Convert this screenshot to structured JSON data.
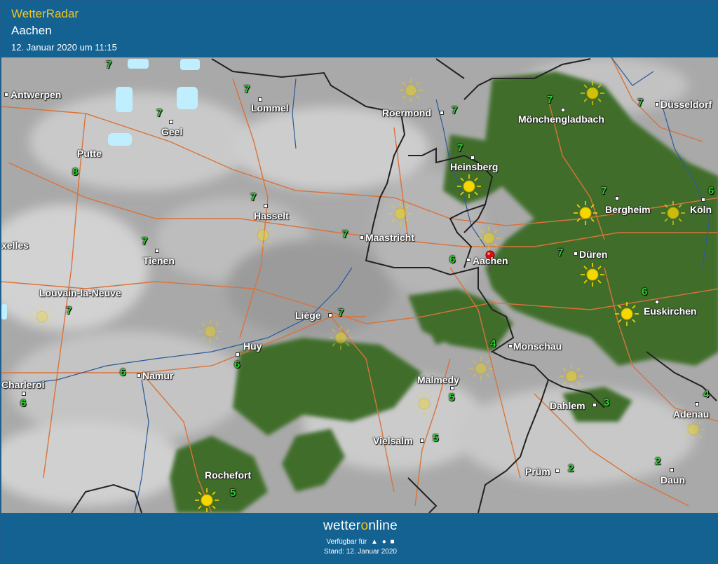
{
  "header": {
    "brand": "WetterRadar",
    "city": "Aachen",
    "date": "12. Januar 2020 um 11:15"
  },
  "map": {
    "selected_location": "Aachen",
    "places": [
      {
        "name": "Antwerpen",
        "id": "antwerpen"
      },
      {
        "name": "Lommel",
        "id": "lommel"
      },
      {
        "name": "Roermond",
        "id": "roermond"
      },
      {
        "name": "Mönchengladbach",
        "id": "moenchengladbach"
      },
      {
        "name": "Düsseldorf",
        "id": "duesseldorf"
      },
      {
        "name": "Geel",
        "id": "geel"
      },
      {
        "name": "Putte",
        "id": "putte"
      },
      {
        "name": "Heinsberg",
        "id": "heinsberg"
      },
      {
        "name": "Hasselt",
        "id": "hasselt"
      },
      {
        "name": "Bergheim",
        "id": "bergheim"
      },
      {
        "name": "Köln",
        "id": "koeln"
      },
      {
        "name": "Maastricht",
        "id": "maastricht"
      },
      {
        "name": "xelles",
        "id": "bruxelles"
      },
      {
        "name": "Tienen",
        "id": "tienen"
      },
      {
        "name": "Düren",
        "id": "dueren"
      },
      {
        "name": "Aachen",
        "id": "aachen"
      },
      {
        "name": "Louvain-la-Neuve",
        "id": "louvain"
      },
      {
        "name": "Euskirchen",
        "id": "euskirchen"
      },
      {
        "name": "Liège",
        "id": "liege"
      },
      {
        "name": "Huy",
        "id": "huy"
      },
      {
        "name": "Monschau",
        "id": "monschau"
      },
      {
        "name": "Namur",
        "id": "namur"
      },
      {
        "name": "Charleroi",
        "id": "charleroi"
      },
      {
        "name": "Malmedy",
        "id": "malmedy"
      },
      {
        "name": "Dahlem",
        "id": "dahlem"
      },
      {
        "name": "Adenau",
        "id": "adenau"
      },
      {
        "name": "Vielsalm",
        "id": "vielsalm"
      },
      {
        "name": "Rochefort",
        "id": "rochefort"
      },
      {
        "name": "Prüm",
        "id": "pruem"
      },
      {
        "name": "Daun",
        "id": "daun"
      }
    ],
    "temperatures": [
      {
        "id": "t-north",
        "value": "7"
      },
      {
        "id": "t-lommel",
        "value": "7"
      },
      {
        "id": "t-roermond",
        "value": "7"
      },
      {
        "id": "t-mg",
        "value": "7"
      },
      {
        "id": "t-dus",
        "value": "7"
      },
      {
        "id": "t-geel",
        "value": "7"
      },
      {
        "id": "t-putte",
        "value": "8"
      },
      {
        "id": "t-heinsberg",
        "value": "7"
      },
      {
        "id": "t-hasselt",
        "value": "7"
      },
      {
        "id": "t-bergheim",
        "value": "7"
      },
      {
        "id": "t-koeln",
        "value": "6"
      },
      {
        "id": "t-maastricht",
        "value": "7"
      },
      {
        "id": "t-tienen",
        "value": "7"
      },
      {
        "id": "t-dueren",
        "value": "7"
      },
      {
        "id": "t-aachen",
        "value": "6"
      },
      {
        "id": "t-louvain",
        "value": "7"
      },
      {
        "id": "t-euskirchen",
        "value": "6"
      },
      {
        "id": "t-liege",
        "value": "7"
      },
      {
        "id": "t-huy",
        "value": "6"
      },
      {
        "id": "t-monschau",
        "value": "4"
      },
      {
        "id": "t-namur",
        "value": "6"
      },
      {
        "id": "t-charleroi",
        "value": "6"
      },
      {
        "id": "t-malmedy",
        "value": "5"
      },
      {
        "id": "t-dahlem",
        "value": "3"
      },
      {
        "id": "t-adenau",
        "value": "4"
      },
      {
        "id": "t-vielsalm",
        "value": "5"
      },
      {
        "id": "t-rochefort",
        "value": "5"
      },
      {
        "id": "t-pruem",
        "value": "2"
      },
      {
        "id": "t-daun",
        "value": "2"
      }
    ],
    "colors": {
      "cloud": "#a9a9a9",
      "forest": "#3c6b2a",
      "roads": "#d9733a",
      "borders": "#222222",
      "rivers": "#2a5a9a",
      "temperature": "#2fd12f",
      "sun": "#f5d800",
      "rain": "#bfeeff"
    }
  },
  "footer": {
    "logo_prefix": "wetter",
    "logo_o": "o",
    "logo_suffix": "nline",
    "available": "Verfügbar für",
    "stand": "Stand: 12. Januar 2020",
    "platform_icons": [
      "android-icon",
      "apple-icon",
      "windows-icon"
    ]
  }
}
